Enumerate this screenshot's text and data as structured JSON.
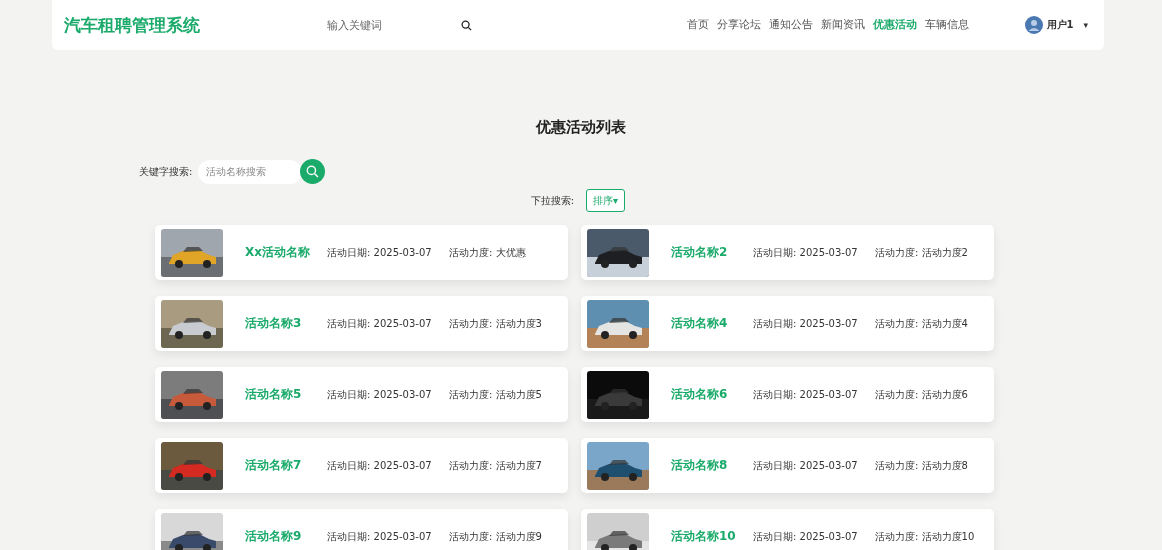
{
  "header": {
    "logo": "汽车租聘管理系统",
    "search": {
      "placeholder": "输入关键词"
    },
    "nav": [
      {
        "label": "首页",
        "selected": false
      },
      {
        "label": "分享论坛",
        "selected": false
      },
      {
        "label": "通知公告",
        "selected": false
      },
      {
        "label": "新闻资讯",
        "selected": false
      },
      {
        "label": "优惠活动",
        "selected": true
      },
      {
        "label": "车辆信息",
        "selected": false
      }
    ],
    "user": {
      "name": "用户1",
      "caret": "▾"
    }
  },
  "page_title": "优惠活动列表",
  "keyword_search": {
    "label": "关键字搜索:",
    "placeholder": "活动名称搜索"
  },
  "dropdown_search": {
    "label": "下拉搜索:",
    "button": "排序",
    "caret": "▾"
  },
  "activities": [
    {
      "name": "Xx活动名称",
      "date": "活动日期: 2025-03-07",
      "level": "活动力度: 大优惠"
    },
    {
      "name": "活动名称2",
      "date": "活动日期: 2025-03-07",
      "level": "活动力度: 活动力度2"
    },
    {
      "name": "活动名称3",
      "date": "活动日期: 2025-03-07",
      "level": "活动力度: 活动力度3"
    },
    {
      "name": "活动名称4",
      "date": "活动日期: 2025-03-07",
      "level": "活动力度: 活动力度4"
    },
    {
      "name": "活动名称5",
      "date": "活动日期: 2025-03-07",
      "level": "活动力度: 活动力度5"
    },
    {
      "name": "活动名称6",
      "date": "活动日期: 2025-03-07",
      "level": "活动力度: 活动力度6"
    },
    {
      "name": "活动名称7",
      "date": "活动日期: 2025-03-07",
      "level": "活动力度: 活动力度7"
    },
    {
      "name": "活动名称8",
      "date": "活动日期: 2025-03-07",
      "level": "活动力度: 活动力度8"
    },
    {
      "name": "活动名称9",
      "date": "活动日期: 2025-03-07",
      "level": "活动力度: 活动力度9"
    },
    {
      "name": "活动名称10",
      "date": "活动日期: 2025-03-07",
      "level": "活动力度: 活动力度10"
    }
  ]
}
